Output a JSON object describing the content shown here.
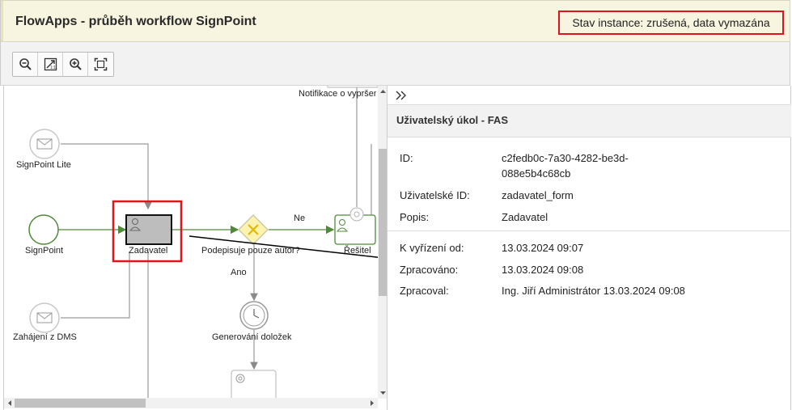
{
  "header": {
    "title": "FlowApps - průběh workflow SignPoint",
    "status": "Stav instance: zrušená, data vymazána"
  },
  "toolbar": {
    "buttons": [
      "zoom-out-icon",
      "fit-icon",
      "zoom-in-icon",
      "fullscreen-icon"
    ]
  },
  "diagram": {
    "nodes": {
      "signpoint_lite": "SignPoint Lite",
      "signpoint": "SignPoint",
      "zahajeni": "Zahájení z DMS",
      "zadavatel": "Zadavatel",
      "gateway": "Podepisuje pouze autor?",
      "resitel": "Řešitel",
      "generovani": "Generování doložek",
      "notifikace": "Notifikace o vypršení"
    },
    "edges": {
      "ne": "Ne",
      "ano": "Ano"
    }
  },
  "panel": {
    "title": "Uživatelský úkol - FAS",
    "fields": [
      {
        "label": "ID:",
        "value": "c2fedb0c-7a30-4282-be3d-088e5b4c68cb"
      },
      {
        "label": "Uživatelské ID:",
        "value": "zadavatel_form"
      },
      {
        "label": "Popis:",
        "value": "Zadavatel"
      },
      {
        "label": "K vyřízení od:",
        "value": "13.03.2024 09:07"
      },
      {
        "label": "Zpracováno:",
        "value": "13.03.2024 09:08"
      },
      {
        "label": "Zpracoval:",
        "value": "Ing. Jiří Administrátor 13.03.2024 09:08"
      }
    ]
  },
  "colors": {
    "highlight": "#e0141c",
    "flow": "#4f8a3a",
    "gateway_fill": "#fdf3b0"
  }
}
